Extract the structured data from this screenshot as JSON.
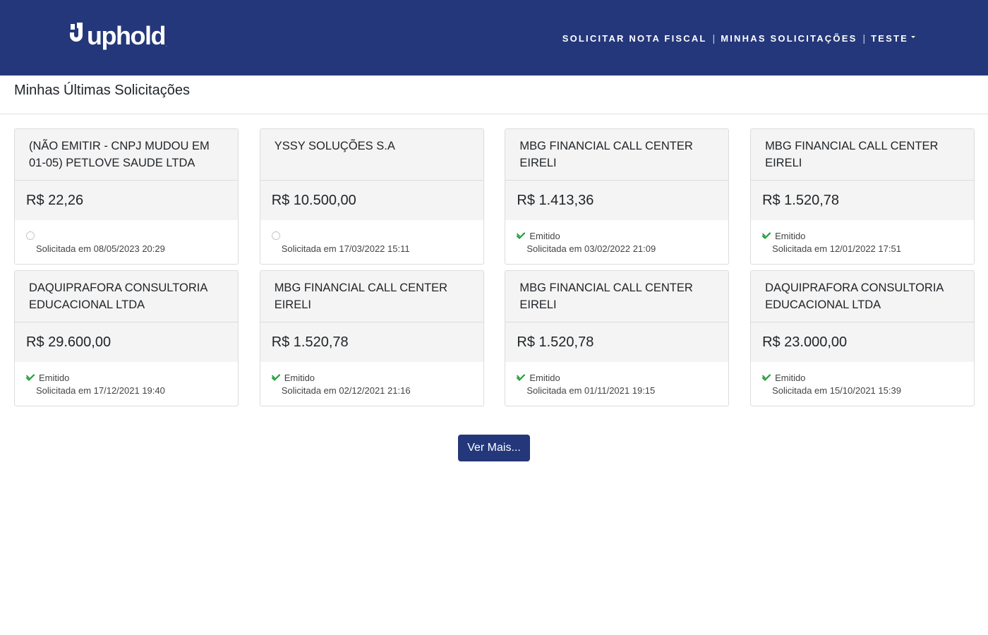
{
  "brand": {
    "name": "uphold",
    "logo_icon": "uphold-logo-icon",
    "tm": "."
  },
  "nav": {
    "items": [
      {
        "label": "SOLICITAR NOTA FISCAL"
      },
      {
        "label": "MINHAS SOLICITAÇÕES"
      },
      {
        "label": "TESTE"
      }
    ],
    "separator": "|"
  },
  "page": {
    "title": "Minhas Últimas Solicitações"
  },
  "cards": [
    {
      "company": "(NÃO EMITIR - CNPJ MUDOU EM 01-05) PETLOVE SAUDE LTDA",
      "value": "R$ 22,26",
      "status": "",
      "status_icon": "pending-circle-icon",
      "date": "Solicitada em 08/05/2023 20:29"
    },
    {
      "company": "YSSY SOLUÇÕES S.A",
      "value": "R$ 10.500,00",
      "status": "",
      "status_icon": "pending-circle-icon",
      "date": "Solicitada em 17/03/2022 15:11"
    },
    {
      "company": "MBG FINANCIAL CALL CENTER EIRELI",
      "value": "R$ 1.413,36",
      "status": "Emitido",
      "status_icon": "check-double-icon",
      "date": "Solicitada em 03/02/2022 21:09"
    },
    {
      "company": "MBG FINANCIAL CALL CENTER EIRELI",
      "value": "R$ 1.520,78",
      "status": "Emitido",
      "status_icon": "check-double-icon",
      "date": "Solicitada em 12/01/2022 17:51"
    },
    {
      "company": "DAQUIPRAFORA CONSULTORIA EDUCACIONAL LTDA",
      "value": "R$ 29.600,00",
      "status": "Emitido",
      "status_icon": "check-double-icon",
      "date": "Solicitada em 17/12/2021 19:40"
    },
    {
      "company": "MBG FINANCIAL CALL CENTER EIRELI",
      "value": "R$ 1.520,78",
      "status": "Emitido",
      "status_icon": "check-double-icon",
      "date": "Solicitada em 02/12/2021 21:16"
    },
    {
      "company": "MBG FINANCIAL CALL CENTER EIRELI",
      "value": "R$ 1.520,78",
      "status": "Emitido",
      "status_icon": "check-double-icon",
      "date": "Solicitada em 01/11/2021 19:15"
    },
    {
      "company": "DAQUIPRAFORA CONSULTORIA EDUCACIONAL LTDA",
      "value": "R$ 23.000,00",
      "status": "Emitido",
      "status_icon": "check-double-icon",
      "date": "Solicitada em 15/10/2021 15:39"
    }
  ],
  "load_more": {
    "label": "Ver Mais..."
  },
  "colors": {
    "navbar": "#24377a",
    "button": "#24377a",
    "success": "#1e9e3a",
    "card_header": "#f4f4f4"
  }
}
